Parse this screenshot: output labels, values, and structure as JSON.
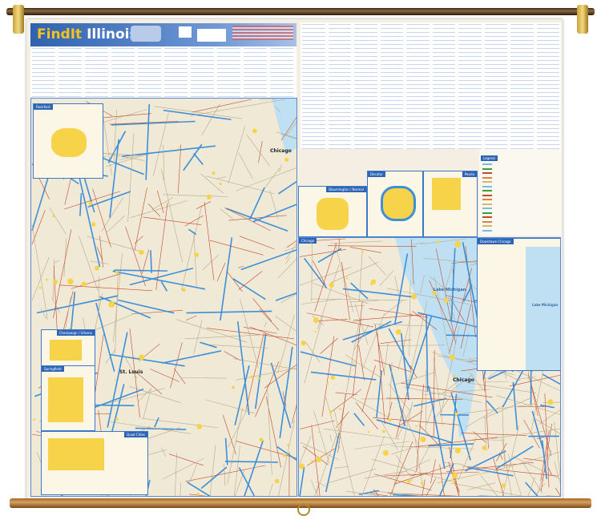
{
  "title": {
    "prefix": "FindIt",
    "name": "Illinois"
  },
  "index": {
    "heading": "Index"
  },
  "legend": {
    "heading": "Legend"
  },
  "insets": {
    "rockford": "Rockford",
    "bloomington": "Bloomington / Normal",
    "decatur": "Decatur",
    "peoria": "Peoria",
    "downtown_chicago": "Downtown Chicago",
    "chicago": "Chicago",
    "champaign": "Champaign / Urbana",
    "springfield": "Springfield",
    "quad_cities": "Quad Cities"
  },
  "labels": {
    "chicago": "Chicago",
    "st_louis": "St. Louis",
    "lake_michigan": "Lake Michigan",
    "lake_michigan_2": "Lake Michigan"
  },
  "colors": {
    "water": "#bfe0f2",
    "interstate": "#3d8fd8",
    "highway": "#c0492f",
    "urban": "#f7d34a",
    "header": "#2f62b0",
    "wood": "#a0692a"
  }
}
